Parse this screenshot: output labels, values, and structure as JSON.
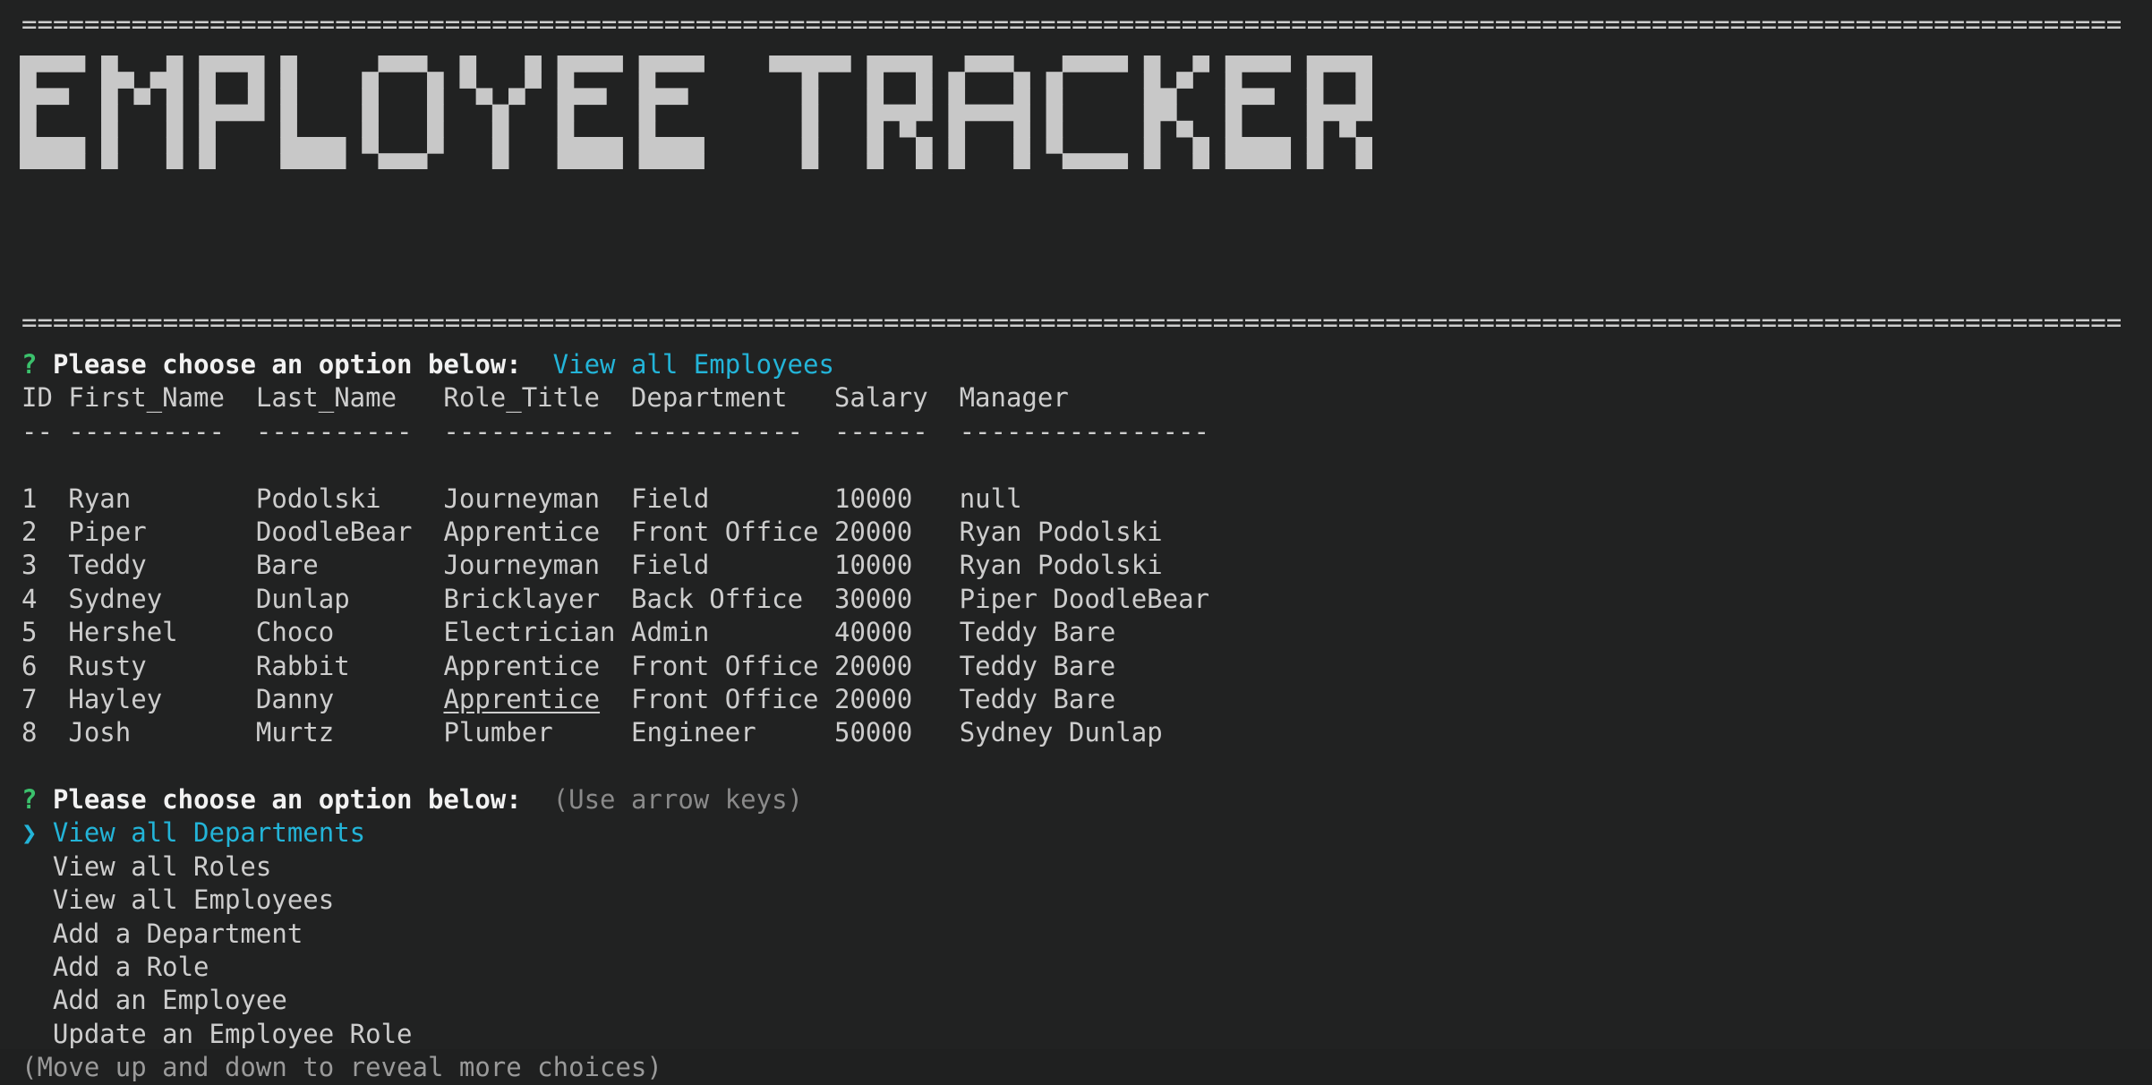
{
  "app": {
    "title_ascii": "EMPLOYEE TRACKER",
    "title_plain": "EMPLOYEE TRACKER",
    "rule_char": "=",
    "rule_length": 134
  },
  "colors": {
    "background": "#212222",
    "foreground": "#cdcdcd",
    "prompt_mark": "#3bc16c",
    "accent_cyan": "#23b4d8",
    "dim": "#8a8a8a",
    "banner": "#c8c8c8"
  },
  "answered_prompt": {
    "mark": "?",
    "question": "Please choose an option below:",
    "answer": "View all Employees"
  },
  "table": {
    "columns": [
      "ID",
      "First_Name",
      "Last_Name",
      "Role_Title",
      "Department",
      "Salary",
      "Manager"
    ],
    "divider_widths": [
      2,
      10,
      10,
      11,
      11,
      6,
      16
    ],
    "column_starts": [
      0,
      3,
      15,
      27,
      39,
      52,
      60
    ],
    "rows": [
      {
        "id": "1",
        "first_name": "Ryan",
        "last_name": "Podolski",
        "role_title": "Journeyman",
        "department": "Field",
        "salary": "10000",
        "manager": "null"
      },
      {
        "id": "2",
        "first_name": "Piper",
        "last_name": "DoodleBear",
        "role_title": "Apprentice",
        "department": "Front Office",
        "salary": "20000",
        "manager": "Ryan Podolski"
      },
      {
        "id": "3",
        "first_name": "Teddy",
        "last_name": "Bare",
        "role_title": "Journeyman",
        "department": "Field",
        "salary": "10000",
        "manager": "Ryan Podolski"
      },
      {
        "id": "4",
        "first_name": "Sydney",
        "last_name": "Dunlap",
        "role_title": "Bricklayer",
        "department": "Back Office",
        "salary": "30000",
        "manager": "Piper DoodleBear"
      },
      {
        "id": "5",
        "first_name": "Hershel",
        "last_name": "Choco",
        "role_title": "Electrician",
        "department": "Admin",
        "salary": "40000",
        "manager": "Teddy Bare"
      },
      {
        "id": "6",
        "first_name": "Rusty",
        "last_name": "Rabbit",
        "role_title": "Apprentice",
        "department": "Front Office",
        "salary": "20000",
        "manager": "Teddy Bare"
      },
      {
        "id": "7",
        "first_name": "Hayley",
        "last_name": "Danny",
        "role_title": "Apprentice",
        "department": "Front Office",
        "salary": "20000",
        "manager": "Teddy Bare",
        "role_title_underlined": true
      },
      {
        "id": "8",
        "first_name": "Josh",
        "last_name": "Murtz",
        "role_title": "Plumber",
        "department": "Engineer",
        "salary": "50000",
        "manager": "Sydney Dunlap"
      }
    ]
  },
  "active_prompt": {
    "mark": "?",
    "question": "Please choose an option below:",
    "hint": "(Use arrow keys)",
    "pointer": "❯",
    "footer": "(Move up and down to reveal more choices)",
    "selected_index": 0,
    "options": [
      "View all Departments",
      "View all Roles",
      "View all Employees",
      "Add a Department",
      "Add a Role",
      "Add an Employee",
      "Update an Employee Role"
    ]
  }
}
